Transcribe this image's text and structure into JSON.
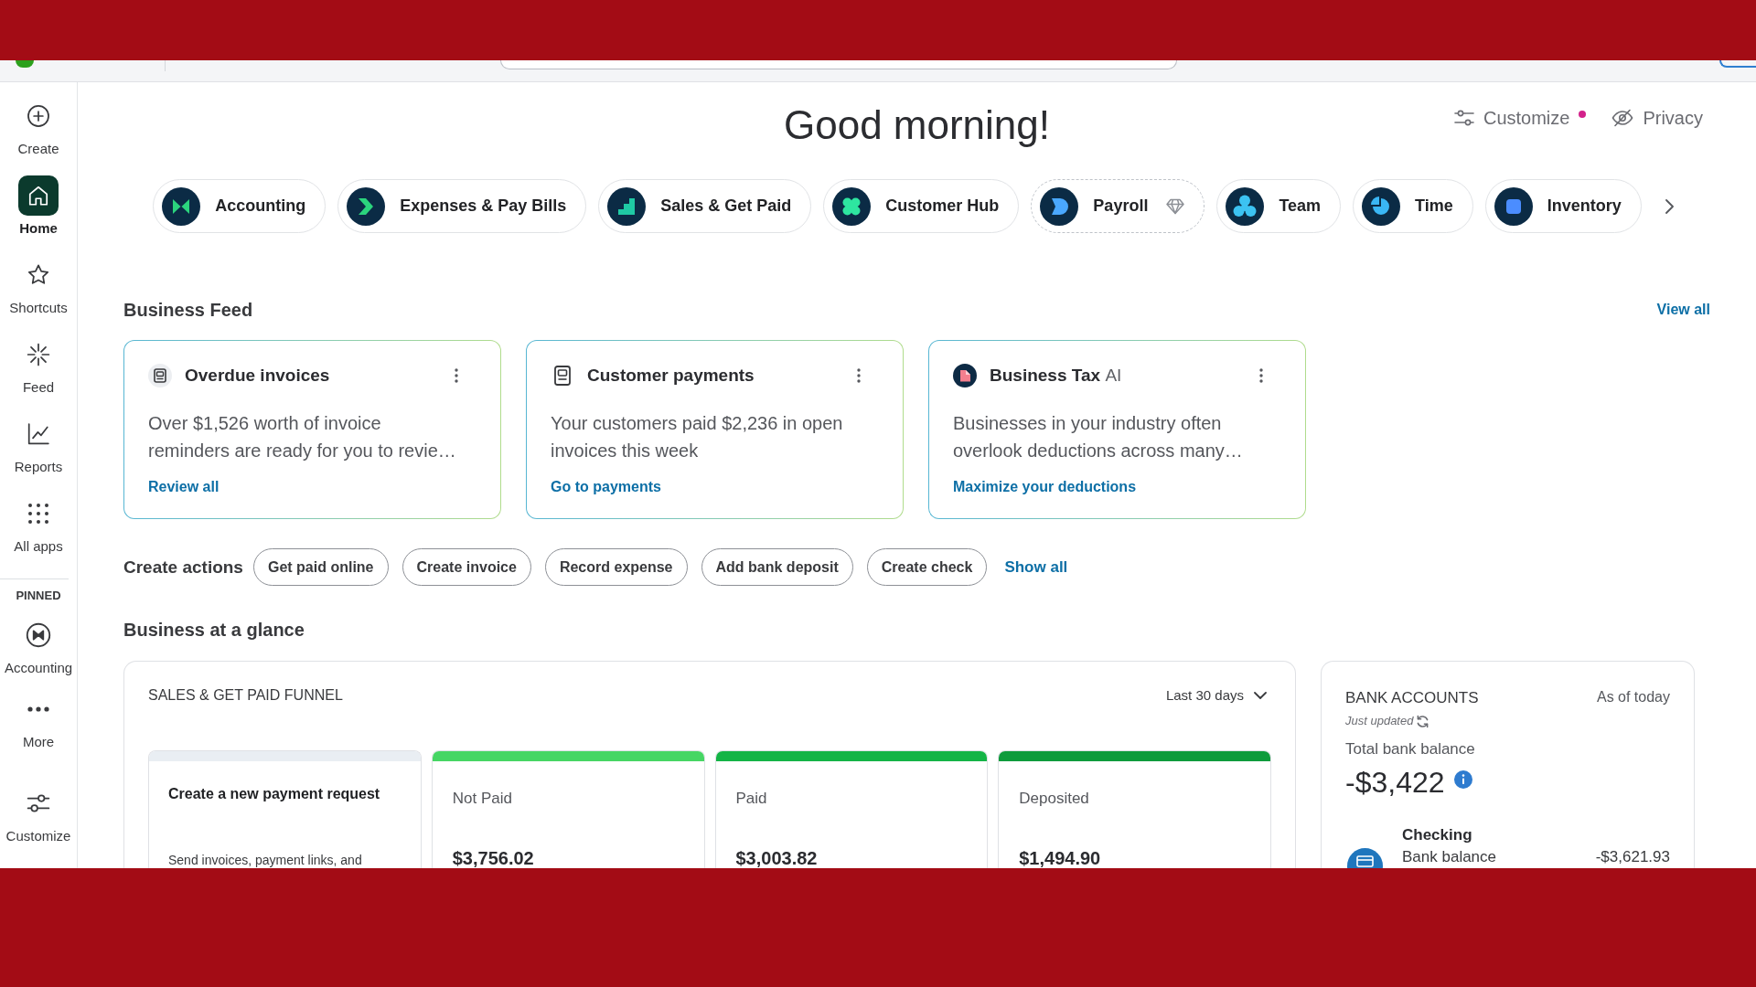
{
  "sidebar": {
    "items": [
      {
        "label": "Create",
        "selected": false
      },
      {
        "label": "Home",
        "selected": true
      },
      {
        "label": "Shortcuts",
        "selected": false
      },
      {
        "label": "Feed",
        "selected": false
      },
      {
        "label": "Reports",
        "selected": false
      },
      {
        "label": "All apps",
        "selected": false
      }
    ],
    "pinned": {
      "heading": "PINNED",
      "items": [
        {
          "label": "Accounting",
          "selected": false
        }
      ]
    },
    "footer_items": [
      {
        "label": "More"
      },
      {
        "label": "Customize"
      }
    ]
  },
  "header": {
    "greeting": "Good morning!",
    "actions": [
      {
        "label": "Customize",
        "alert": true
      },
      {
        "label": "Privacy",
        "alert": false
      }
    ]
  },
  "apps": [
    {
      "label": "Accounting",
      "premium": false
    },
    {
      "label": "Expenses & Pay Bills",
      "premium": false
    },
    {
      "label": "Sales & Get Paid",
      "premium": false
    },
    {
      "label": "Customer Hub",
      "premium": false
    },
    {
      "label": "Payroll",
      "premium": true
    },
    {
      "label": "Team",
      "premium": false
    },
    {
      "label": "Time",
      "premium": false
    },
    {
      "label": "Inventory",
      "premium": false
    }
  ],
  "business_feed": {
    "title": "Business Feed",
    "view_all": "View all",
    "cards": [
      {
        "title": "Overdue invoices",
        "text": "Over $1,526 worth of invoice reminders are ready for you to revie…",
        "link": "Review all"
      },
      {
        "title": "Customer payments",
        "text": "Your customers paid $2,236 in open invoices this week",
        "link": "Go to payments"
      },
      {
        "title": "Business Tax",
        "title_suffix": "AI",
        "text": "Businesses in your industry often overlook deductions across many…",
        "link": "Maximize your deductions"
      }
    ]
  },
  "create_actions": {
    "title": "Create actions",
    "buttons": [
      "Get paid online",
      "Create invoice",
      "Record expense",
      "Add bank deposit",
      "Create check"
    ],
    "show_all": "Show all"
  },
  "business_at_a_glance": {
    "title": "Business at a glance",
    "funnel": {
      "title": "SALES & GET PAID FUNNEL",
      "period": "Last 30 days",
      "request": {
        "title": "Create a new payment request",
        "text": "Send invoices, payment links, and"
      },
      "stages": [
        {
          "label": "Not Paid",
          "amount": "$3,756.02",
          "color": "#46d664"
        },
        {
          "label": "Paid",
          "amount": "$3,003.82",
          "color": "#14b446"
        },
        {
          "label": "Deposited",
          "amount": "$1,494.90",
          "color": "#0e9b3c"
        }
      ]
    },
    "bank_accounts": {
      "title": "BANK ACCOUNTS",
      "as_of": "As of today",
      "status": "Just updated",
      "total_label": "Total bank balance",
      "total": "-$3,422",
      "accounts": [
        {
          "name": "Checking",
          "balance_label": "Bank balance",
          "balance": "-$3,621.93"
        }
      ]
    }
  }
}
